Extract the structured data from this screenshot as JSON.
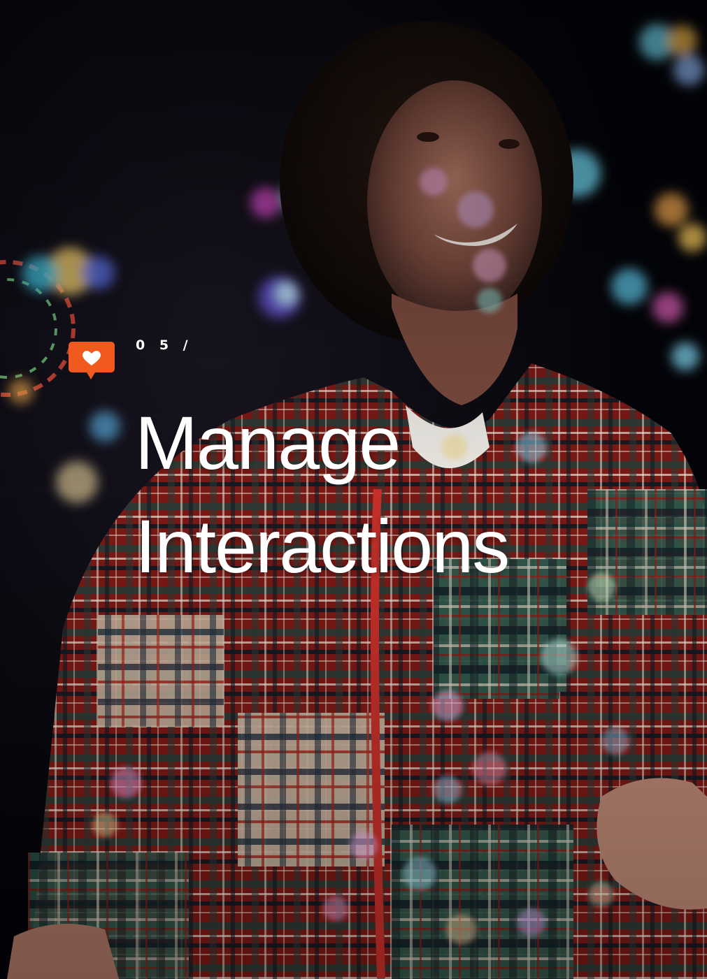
{
  "section": {
    "number": "0 5  /",
    "icon": "heart-speech-bubble-icon",
    "accent_color": "#f05a1e"
  },
  "title": {
    "line1": "Manage",
    "line2": "Interactions"
  },
  "image": {
    "description_icon": "photo-woman-plaid-jacket-bubbles",
    "background_color": "#05070d"
  }
}
